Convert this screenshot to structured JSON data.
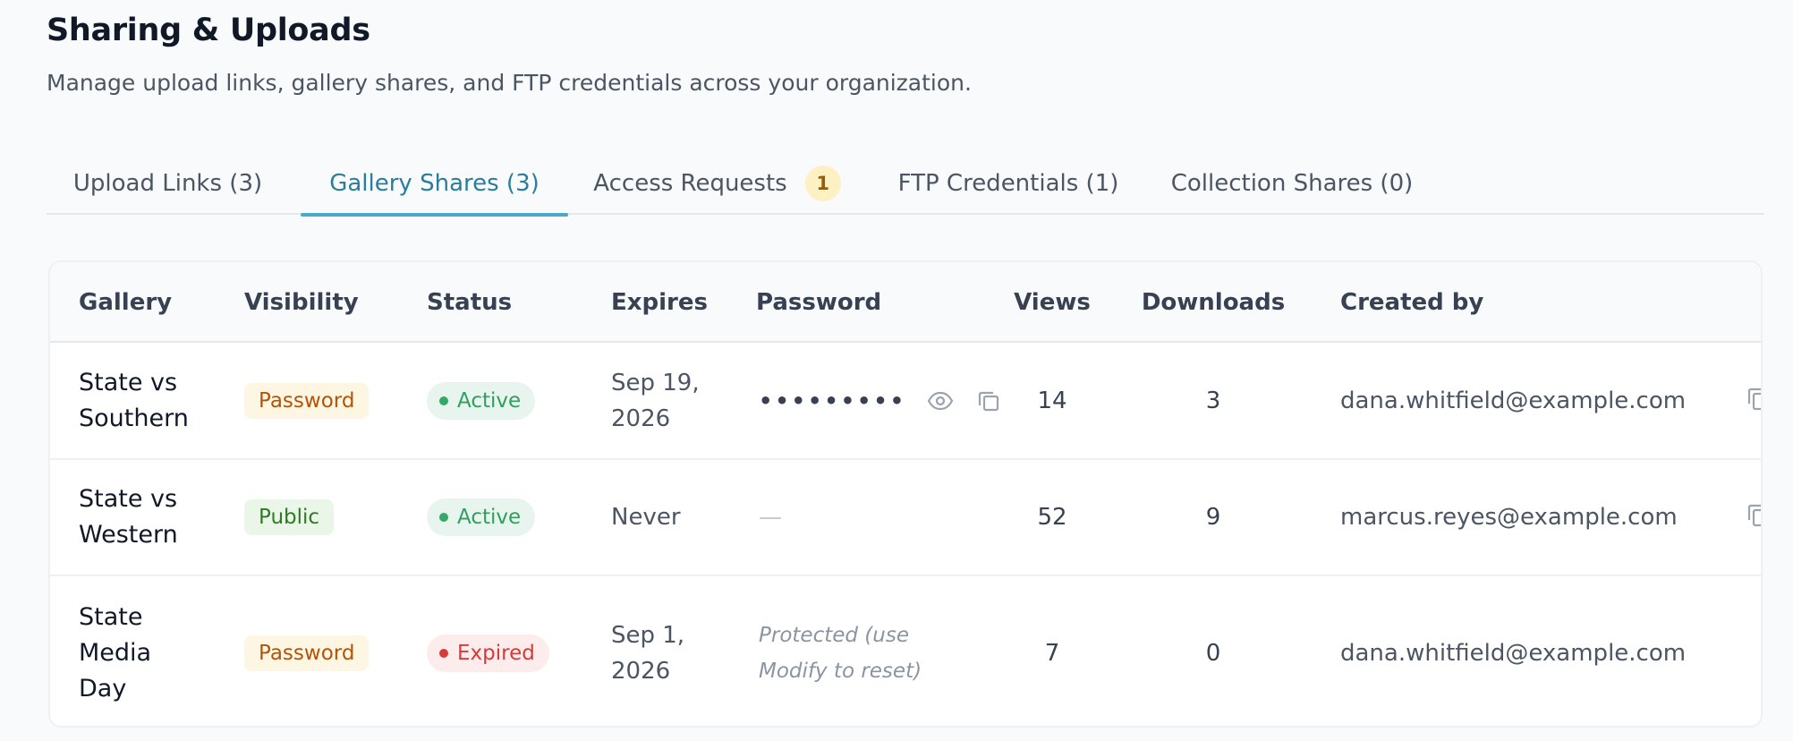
{
  "header": {
    "title": "Sharing & Uploads",
    "subtitle": "Manage upload links, gallery shares, and FTP credentials across your organization."
  },
  "tabs": [
    {
      "label": "Upload Links (3)"
    },
    {
      "label": "Gallery Shares (3)",
      "active": true
    },
    {
      "label": "Access Requests",
      "badge": "1"
    },
    {
      "label": "FTP Credentials (1)"
    },
    {
      "label": "Collection Shares (0)"
    }
  ],
  "table": {
    "columns": [
      "Gallery",
      "Visibility",
      "Status",
      "Expires",
      "Password",
      "Views",
      "Downloads",
      "Created by"
    ],
    "rows": [
      {
        "gallery_line1": "State vs",
        "gallery_line2": "Southern",
        "gallery_line3": "",
        "visibility": "Password",
        "status": "Active",
        "expires_line1": "Sep 19,",
        "expires_line2": "2026",
        "password_masked": "•••••••••",
        "views": "14",
        "downloads": "3",
        "created_by": "dana.whitfield@example.com"
      },
      {
        "gallery_line1": "State vs",
        "gallery_line2": "Western",
        "gallery_line3": "",
        "visibility": "Public",
        "status": "Active",
        "expires_line1": "Never",
        "expires_line2": "",
        "password_dash": "—",
        "views": "52",
        "downloads": "9",
        "created_by": "marcus.reyes@example.com"
      },
      {
        "gallery_line1": "State",
        "gallery_line2": "Media",
        "gallery_line3": "Day",
        "visibility": "Password",
        "status": "Expired",
        "expires_line1": "Sep 1,",
        "expires_line2": "2026",
        "password_note_line1": "Protected (use",
        "password_note_line2": "Modify to reset)",
        "views": "7",
        "downloads": "0",
        "created_by": "dana.whitfield@example.com"
      }
    ]
  },
  "icons": {
    "show_password": "eye-icon",
    "copy_password": "copy-icon",
    "copy_link": "copy-icon"
  },
  "colors": {
    "accent": "#2a7e9c",
    "active_status": "#2f9e5f",
    "expired_status": "#d63a3a",
    "password_pill": "#b45309",
    "public_pill": "#2f7a24",
    "badge_bg": "#fdf1c4"
  }
}
